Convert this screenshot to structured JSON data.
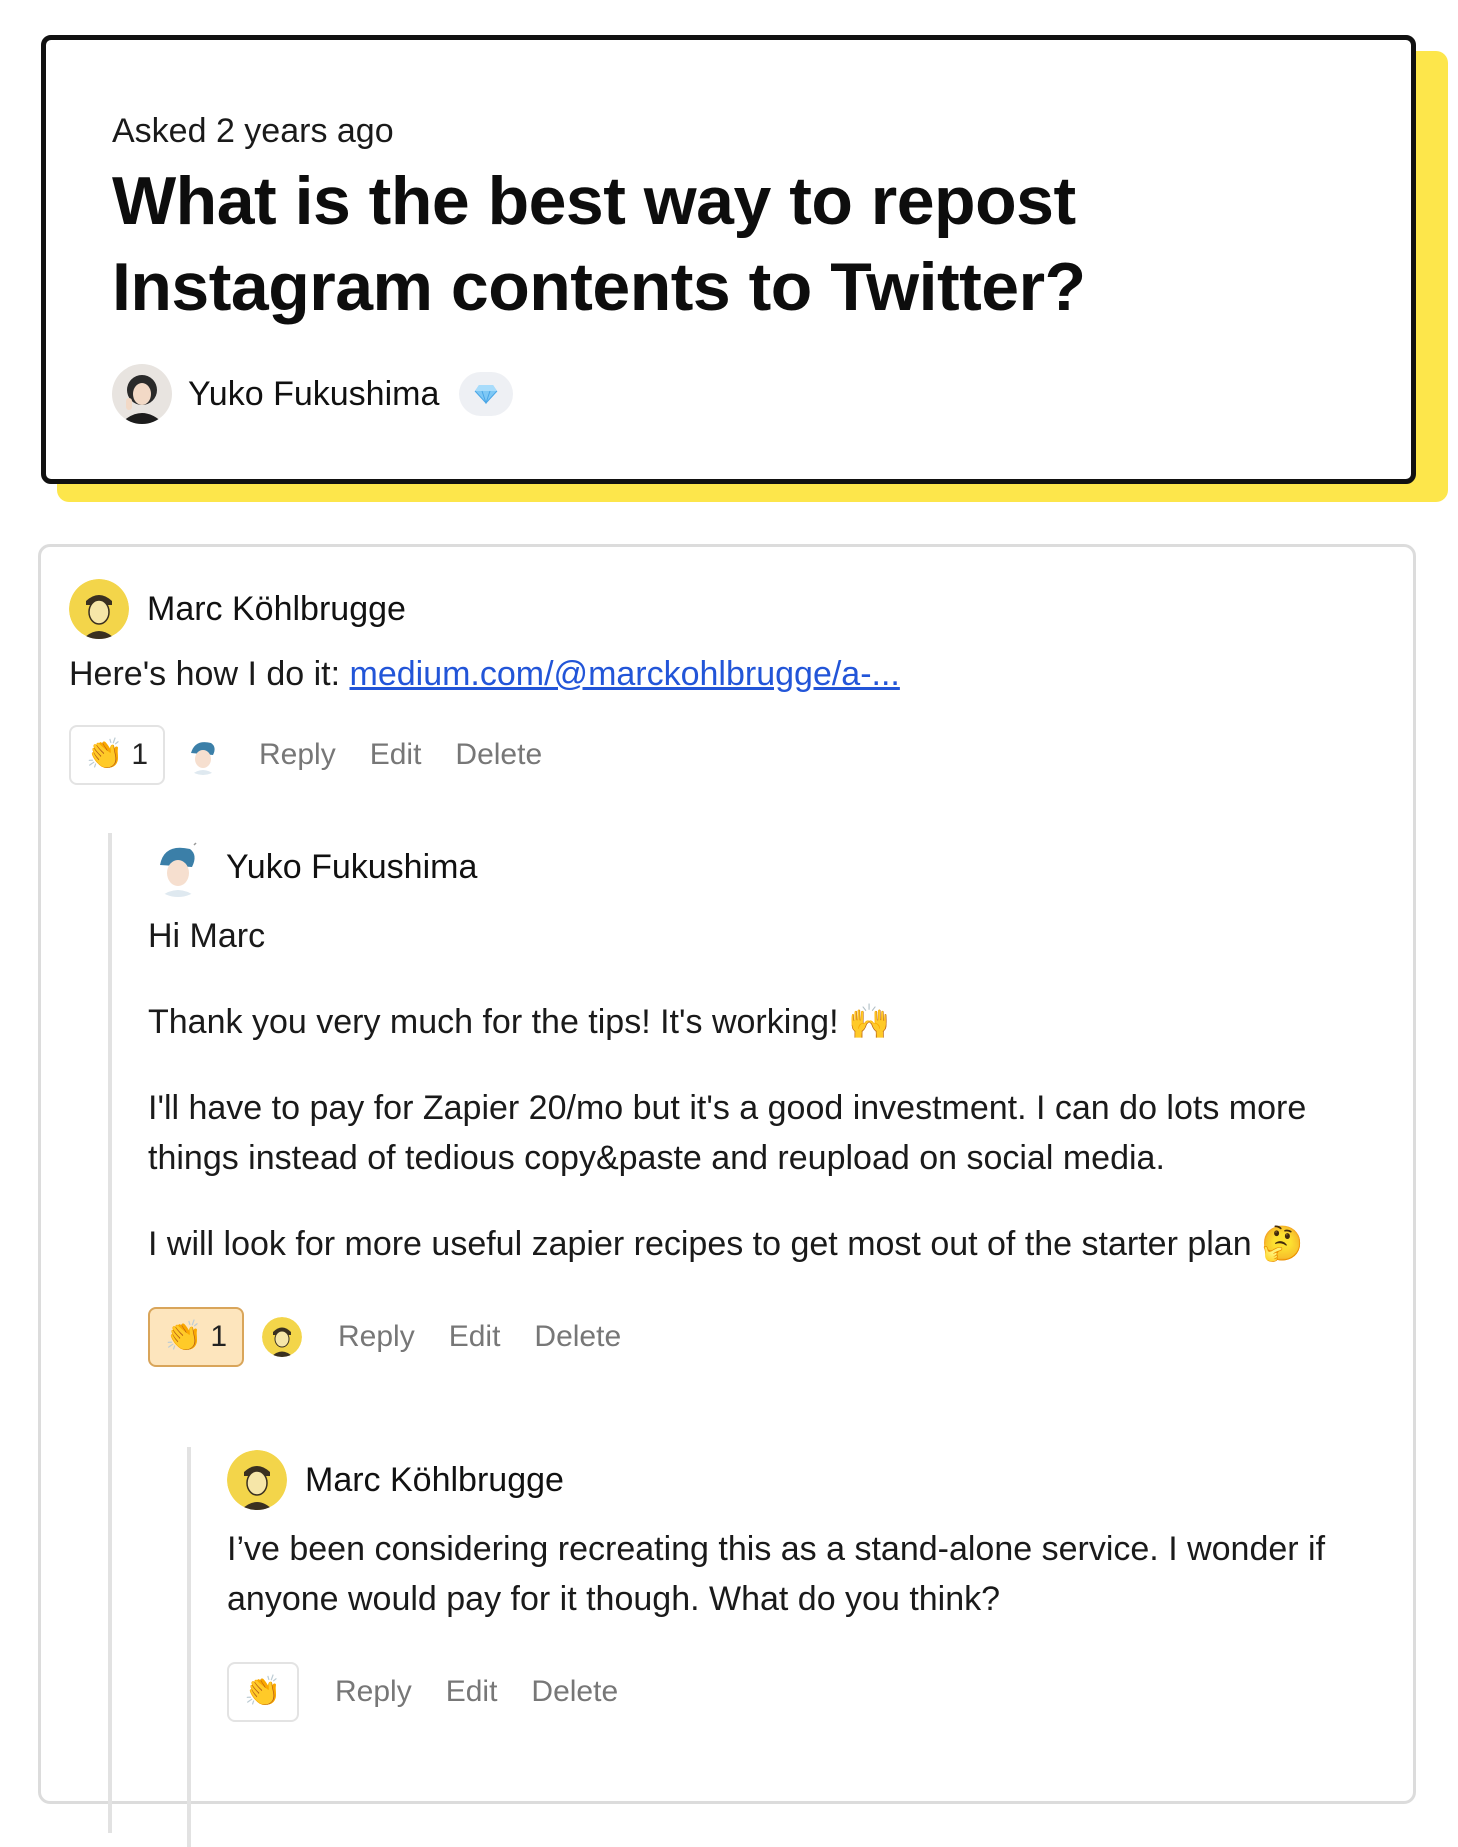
{
  "question": {
    "asked": "Asked 2 years ago",
    "title": "What is the best way to repost Instagram contents to Twitter?",
    "author": "Yuko Fukushima",
    "badge_icon": "gem-icon"
  },
  "comments": [
    {
      "author": "Marc Köhlbrugge",
      "text_prefix": "Here's how I do it: ",
      "link_text": "medium.com/@marckohlbrugge/a-...",
      "clap_emoji": "👏",
      "clap_count": "1",
      "reply": "Reply",
      "edit": "Edit",
      "delete": "Delete"
    },
    {
      "author": "Yuko Fukushima",
      "paragraphs": [
        "Hi Marc",
        "Thank you very much for the tips! It's working! 🙌",
        "I'll have to pay for Zapier 20/mo but it's a good investment. I can do lots more things instead of tedious copy&paste and reupload on social media.",
        "I will look for more useful zapier recipes to get most out of the starter plan 🤔"
      ],
      "clap_emoji": "👏",
      "clap_count": "1",
      "reply": "Reply",
      "edit": "Edit",
      "delete": "Delete"
    },
    {
      "author": "Marc Köhlbrugge",
      "text": "I’ve been considering recreating this as a stand-alone service. I wonder if anyone would pay for it though. What do you think?",
      "clap_emoji": "👏",
      "reply": "Reply",
      "edit": "Edit",
      "delete": "Delete"
    }
  ],
  "colors": {
    "accent_yellow": "#fde64b",
    "link_blue": "#2255d8",
    "clap_active_bg": "#fde5bd"
  }
}
